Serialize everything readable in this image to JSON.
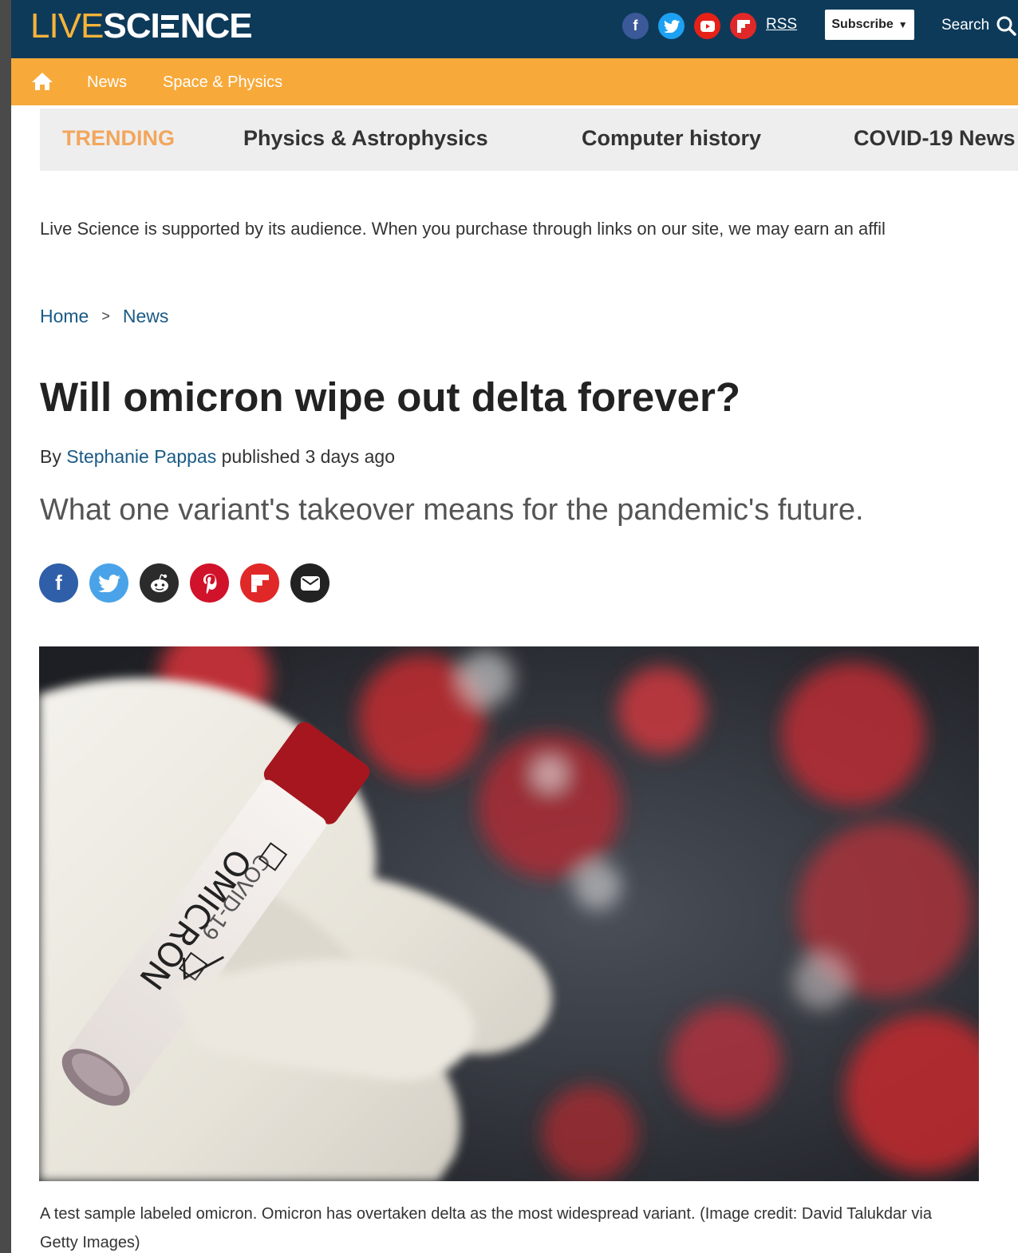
{
  "header": {
    "logo_part1": "LIVE",
    "logo_part2": "SCI",
    "logo_part3": "NCE",
    "social_icons": [
      "facebook-icon",
      "twitter-icon",
      "youtube-icon",
      "flipboard-icon"
    ],
    "rss_label": "RSS",
    "subscribe_label": "Subscribe",
    "search_label": "Search"
  },
  "nav": {
    "items": [
      {
        "label": "News"
      },
      {
        "label": "Space & Physics"
      }
    ]
  },
  "trending": {
    "label": "TRENDING",
    "items": [
      {
        "label": "Physics & Astrophysics"
      },
      {
        "label": "Computer history"
      },
      {
        "label": "COVID-19 News"
      }
    ]
  },
  "affiliate_notice": "Live Science is supported by its audience. When you purchase through links on our site, we may earn an affil",
  "breadcrumb": {
    "home": "Home",
    "separator": ">",
    "current": "News"
  },
  "article": {
    "title": "Will omicron wipe out delta forever?",
    "by_prefix": "By",
    "author": "Stephanie Pappas",
    "published": "published 3 days ago",
    "strapline": "What one variant's takeover means for the pandemic's future.",
    "share_icons": [
      "facebook-icon",
      "twitter-icon",
      "reddit-icon",
      "pinterest-icon",
      "flipboard-icon",
      "email-icon"
    ],
    "image_tube_label": "OMICRON",
    "image_tube_label_top": "COVID-19",
    "caption": "A test sample labeled omicron. Omicron has overtaken delta as the most widespread variant. (Image credit: David Talukdar via Getty Images)"
  },
  "colors": {
    "topbar": "#0e3a5a",
    "navbar": "#f7a93a",
    "link": "#1a5a86",
    "trending_label": "#f2a65b"
  }
}
